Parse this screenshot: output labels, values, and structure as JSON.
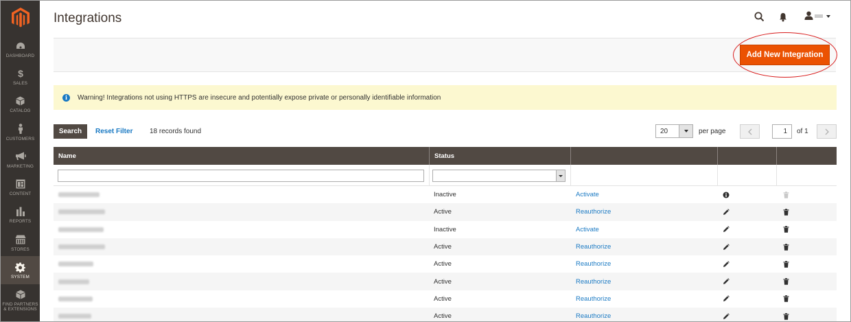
{
  "header": {
    "title": "Integrations"
  },
  "sidebar": {
    "items": [
      {
        "label": "DASHBOARD",
        "icon": "dashboard-icon"
      },
      {
        "label": "SALES",
        "icon": "dollar-icon"
      },
      {
        "label": "CATALOG",
        "icon": "cube-icon"
      },
      {
        "label": "CUSTOMERS",
        "icon": "person-icon"
      },
      {
        "label": "MARKETING",
        "icon": "megaphone-icon"
      },
      {
        "label": "CONTENT",
        "icon": "layout-icon"
      },
      {
        "label": "REPORTS",
        "icon": "bar-chart-icon"
      },
      {
        "label": "STORES",
        "icon": "store-icon"
      },
      {
        "label": "SYSTEM",
        "icon": "gear-icon",
        "active": true
      },
      {
        "label": "FIND PARTNERS & EXTENSIONS",
        "icon": "box-icon"
      }
    ]
  },
  "actions": {
    "add_button": "Add New Integration"
  },
  "warning": {
    "text": "Warning! Integrations not using HTTPS are insecure and potentially expose private or personally identifiable information"
  },
  "toolbar": {
    "search_label": "Search",
    "reset_label": "Reset Filter",
    "records_text": "18 records found",
    "per_page_value": "20",
    "per_page_label": "per page",
    "page_current": "1",
    "page_of": "of 1"
  },
  "grid": {
    "columns": [
      "Name",
      "Status"
    ],
    "rows": [
      {
        "status": "Inactive",
        "action": "Activate",
        "edit_icon": "info-icon",
        "delete_enabled": false
      },
      {
        "status": "Active",
        "action": "Reauthorize",
        "edit_icon": "pencil-icon",
        "delete_enabled": true
      },
      {
        "status": "Inactive",
        "action": "Activate",
        "edit_icon": "pencil-icon",
        "delete_enabled": true
      },
      {
        "status": "Active",
        "action": "Reauthorize",
        "edit_icon": "pencil-icon",
        "delete_enabled": true
      },
      {
        "status": "Active",
        "action": "Reauthorize",
        "edit_icon": "pencil-icon",
        "delete_enabled": true
      },
      {
        "status": "Active",
        "action": "Reauthorize",
        "edit_icon": "pencil-icon",
        "delete_enabled": true
      },
      {
        "status": "Active",
        "action": "Reauthorize",
        "edit_icon": "pencil-icon",
        "delete_enabled": true
      },
      {
        "status": "Active",
        "action": "Reauthorize",
        "edit_icon": "pencil-icon",
        "delete_enabled": true
      }
    ]
  },
  "colors": {
    "sidebar_bg": "#373330",
    "accent_orange": "#eb5202",
    "link_blue": "#1979c3",
    "grid_header": "#514943",
    "warning_bg": "#fcf8d0",
    "highlight_red": "#d81b1b"
  }
}
